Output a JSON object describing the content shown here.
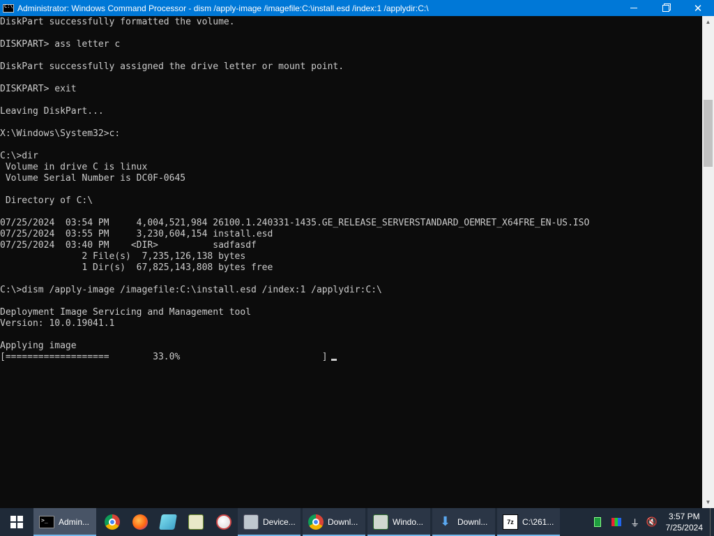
{
  "window": {
    "title": "Administrator: Windows Command Processor - dism  /apply-image /imagefile:C:\\install.esd /index:1 /applydir:C:\\",
    "close_glyph": "✕"
  },
  "console": {
    "lines": [
      "DiskPart successfully formatted the volume.",
      "",
      "DISKPART> ass letter c",
      "",
      "DiskPart successfully assigned the drive letter or mount point.",
      "",
      "DISKPART> exit",
      "",
      "Leaving DiskPart...",
      "",
      "X:\\Windows\\System32>c:",
      "",
      "C:\\>dir",
      " Volume in drive C is linux",
      " Volume Serial Number is DC0F-0645",
      "",
      " Directory of C:\\",
      "",
      "07/25/2024  03:54 PM     4,004,521,984 26100.1.240331-1435.GE_RELEASE_SERVERSTANDARD_OEMRET_X64FRE_EN-US.ISO",
      "07/25/2024  03:55 PM     3,230,604,154 install.esd",
      "07/25/2024  03:40 PM    <DIR>          sadfasdf",
      "               2 File(s)  7,235,126,138 bytes",
      "               1 Dir(s)  67,825,143,808 bytes free",
      "",
      "C:\\>dism /apply-image /imagefile:C:\\install.esd /index:1 /applydir:C:\\",
      "",
      "Deployment Image Servicing and Management tool",
      "Version: 10.0.19041.1",
      "",
      "Applying image"
    ],
    "progress_line": "[===================        33.0%                          ]",
    "progress_percent": 33.0
  },
  "taskbar": {
    "items": [
      {
        "name": "cmd",
        "label": "Admin...",
        "icon": "cmd-icon",
        "active": true
      },
      {
        "name": "chrome",
        "label": "",
        "icon": "chrome-icon"
      },
      {
        "name": "firefox",
        "label": "",
        "icon": "firefox-icon"
      },
      {
        "name": "paint3d",
        "label": "",
        "icon": "paint3d-icon"
      },
      {
        "name": "notepad",
        "label": "",
        "icon": "notepad-icon"
      },
      {
        "name": "paint",
        "label": "",
        "icon": "paint-icon"
      },
      {
        "name": "device",
        "label": "Device...",
        "icon": "device-manager-icon"
      },
      {
        "name": "chrome-download",
        "label": "Downl...",
        "icon": "chrome-icon"
      },
      {
        "name": "windows-setup",
        "label": "Windo...",
        "icon": "windows-setup-icon"
      },
      {
        "name": "downloads",
        "label": "Downl...",
        "icon": "download-icon"
      },
      {
        "name": "sevenzip",
        "label": "C:\\261...",
        "icon": "7zip-icon"
      }
    ],
    "sevenzip_icon_text": "7z",
    "clock": {
      "time": "3:57 PM",
      "date": "7/25/2024"
    }
  }
}
